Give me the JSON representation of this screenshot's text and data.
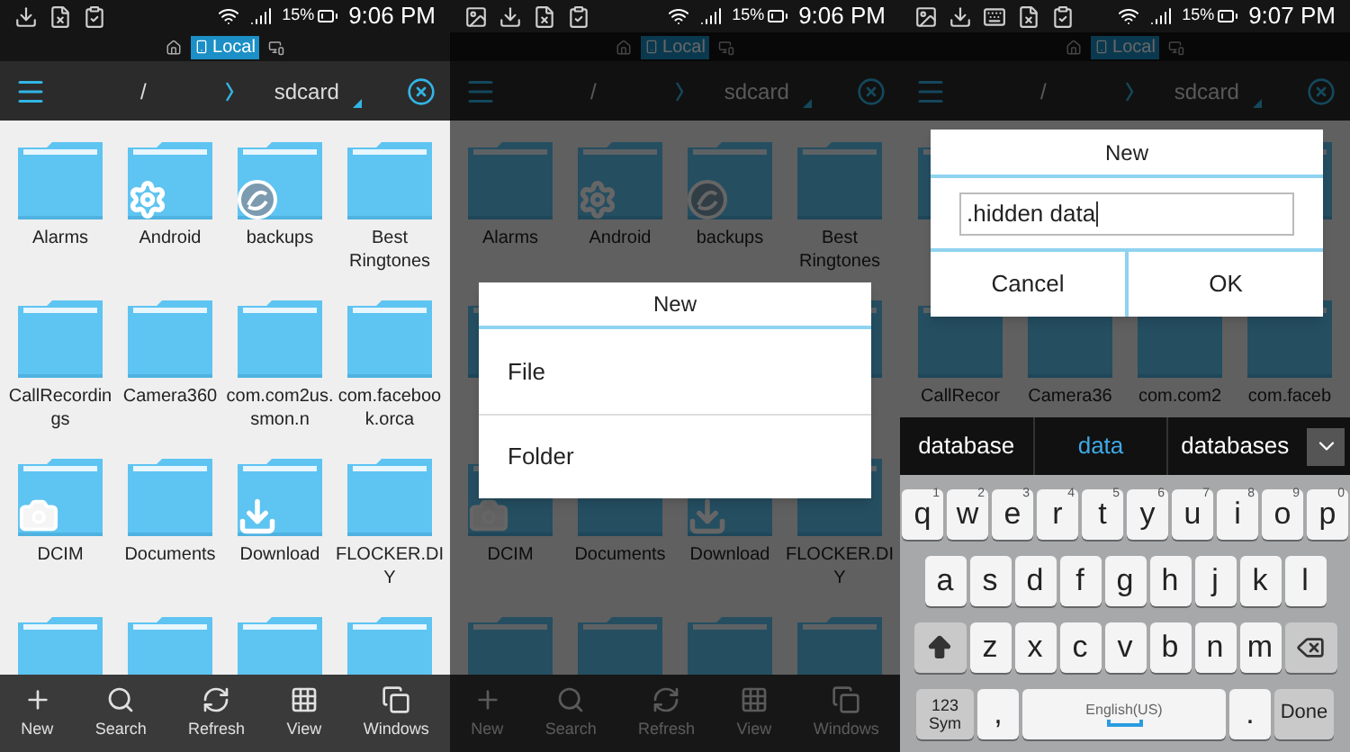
{
  "panels": [
    {
      "status_bar": {
        "icons": [
          {
            "kind": "download"
          },
          {
            "kind": "file"
          },
          {
            "kind": "clipboard"
          }
        ],
        "battery": "15%",
        "time": "9:06 PM"
      },
      "location": {
        "label": "Local"
      },
      "path": {
        "root": "/",
        "folder": "sdcard"
      },
      "dimmed": false,
      "folders": [
        {
          "label": "Alarms",
          "kind": "plain"
        },
        {
          "label": "Android",
          "kind": "settings"
        },
        {
          "label": "backups",
          "kind": "app"
        },
        {
          "label": "Best Ringtones",
          "kind": "plain"
        },
        {
          "label": "CallRecordings",
          "kind": "plain"
        },
        {
          "label": "Camera360",
          "kind": "plain"
        },
        {
          "label": "com.com2us.smon.n",
          "kind": "plain"
        },
        {
          "label": "com.facebook.orca",
          "kind": "plain"
        },
        {
          "label": "DCIM",
          "kind": "camera"
        },
        {
          "label": "Documents",
          "kind": "plain"
        },
        {
          "label": "Download",
          "kind": "download"
        },
        {
          "label": "FLOCKER.DIY",
          "kind": "plain"
        },
        {
          "kind": "plain"
        },
        {
          "kind": "plain"
        },
        {
          "kind": "plain"
        },
        {
          "kind": "plain"
        }
      ],
      "toolbar": [
        {
          "label": "New",
          "kind": "new"
        },
        {
          "label": "Search",
          "kind": "search"
        },
        {
          "label": "Refresh",
          "kind": "refresh"
        },
        {
          "label": "View",
          "kind": "view"
        },
        {
          "label": "Windows",
          "kind": "windows"
        }
      ]
    },
    {
      "status_bar": {
        "icons": [
          {
            "kind": "image"
          },
          {
            "kind": "download"
          },
          {
            "kind": "file"
          },
          {
            "kind": "clipboard"
          }
        ],
        "battery": "15%",
        "time": "9:06 PM"
      },
      "location": {
        "label": "Local"
      },
      "path": {
        "root": "/",
        "folder": "sdcard"
      },
      "dimmed": true,
      "folders": [
        {
          "label": "Alarms",
          "kind": "plain"
        },
        {
          "label": "Android",
          "kind": "settings"
        },
        {
          "label": "backups",
          "kind": "app"
        },
        {
          "label": "Best Ringtones",
          "kind": "plain"
        },
        {
          "kind": "plain"
        },
        {
          "kind": "gap"
        },
        {
          "kind": "gap"
        },
        {
          "kind": "plain"
        },
        {
          "label": "DCIM",
          "kind": "camera"
        },
        {
          "label": "Documents",
          "kind": "plain"
        },
        {
          "label": "Download",
          "kind": "download"
        },
        {
          "label": "FLOCKER.DIY",
          "kind": "plain"
        },
        {
          "kind": "plain"
        },
        {
          "kind": "plain"
        },
        {
          "kind": "plain"
        },
        {
          "kind": "plain"
        }
      ],
      "toolbar": [
        {
          "label": "New",
          "kind": "new"
        },
        {
          "label": "Search",
          "kind": "search"
        },
        {
          "label": "Refresh",
          "kind": "refresh"
        },
        {
          "label": "View",
          "kind": "view"
        },
        {
          "label": "Windows",
          "kind": "windows"
        }
      ],
      "dialog": {
        "kind": "menu",
        "title": "New",
        "items": [
          "File",
          "Folder"
        ]
      }
    },
    {
      "status_bar": {
        "icons": [
          {
            "kind": "image"
          },
          {
            "kind": "download"
          },
          {
            "kind": "keyboard"
          },
          {
            "kind": "file"
          },
          {
            "kind": "clipboard"
          }
        ],
        "battery": "15%",
        "time": "9:07 PM"
      },
      "location": {
        "label": "Local"
      },
      "path": {
        "root": "/",
        "folder": "sdcard"
      },
      "dimmed": true,
      "folders": [
        {
          "kind": "plain"
        },
        {
          "kind": "gap"
        },
        {
          "kind": "gap"
        },
        {
          "kind": "plain"
        },
        {
          "label": "CallRecor",
          "kind": "plain"
        },
        {
          "label": "Camera36",
          "kind": "plain"
        },
        {
          "label": "com.com2",
          "kind": "plain"
        },
        {
          "label": "com.faceb",
          "kind": "plain"
        }
      ],
      "dialog": {
        "kind": "input",
        "title": "New",
        "value": ".hidden data",
        "buttons": [
          "Cancel",
          "OK"
        ]
      },
      "keyboard": {
        "suggestions": [
          {
            "label": "database",
            "selected": false
          },
          {
            "label": "data",
            "selected": true
          },
          {
            "label": "databases",
            "selected": false
          }
        ],
        "rows": [
          {
            "keys": [
              {
                "label": "q",
                "hint": "1",
                "kind": "char"
              },
              {
                "label": "w",
                "hint": "2",
                "kind": "char"
              },
              {
                "label": "e",
                "hint": "3",
                "kind": "char"
              },
              {
                "label": "r",
                "hint": "4",
                "kind": "char"
              },
              {
                "label": "t",
                "hint": "5",
                "kind": "char"
              },
              {
                "label": "y",
                "hint": "6",
                "kind": "char"
              },
              {
                "label": "u",
                "hint": "7",
                "kind": "char"
              },
              {
                "label": "i",
                "hint": "8",
                "kind": "char"
              },
              {
                "label": "o",
                "hint": "9",
                "kind": "char"
              },
              {
                "label": "p",
                "hint": "0",
                "kind": "char"
              }
            ]
          },
          {
            "keys": [
              {
                "label": "a",
                "kind": "char"
              },
              {
                "label": "s",
                "kind": "char"
              },
              {
                "label": "d",
                "kind": "char"
              },
              {
                "label": "f",
                "kind": "char"
              },
              {
                "label": "g",
                "kind": "char"
              },
              {
                "label": "h",
                "kind": "char"
              },
              {
                "label": "j",
                "kind": "char"
              },
              {
                "label": "k",
                "kind": "char"
              },
              {
                "label": "l",
                "kind": "char"
              }
            ]
          },
          {
            "keys": [
              {
                "kind": "shift"
              },
              {
                "label": "z",
                "kind": "char"
              },
              {
                "label": "x",
                "kind": "char"
              },
              {
                "label": "c",
                "kind": "char"
              },
              {
                "label": "v",
                "kind": "char"
              },
              {
                "label": "b",
                "kind": "char"
              },
              {
                "label": "n",
                "kind": "char"
              },
              {
                "label": "m",
                "kind": "char"
              },
              {
                "kind": "backspace"
              }
            ]
          },
          {
            "keys": [
              {
                "label": "123 Sym",
                "kind": "sym"
              },
              {
                "label": ",",
                "kind": "char"
              },
              {
                "label": "English(US)",
                "kind": "space"
              },
              {
                "label": ".",
                "kind": "char"
              },
              {
                "label": "Done",
                "kind": "done"
              }
            ]
          }
        ]
      }
    }
  ]
}
